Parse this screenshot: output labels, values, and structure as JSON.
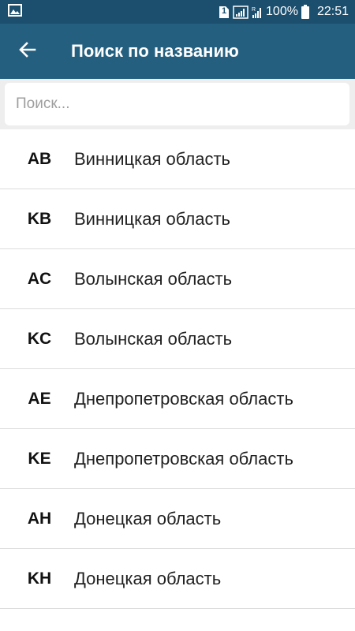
{
  "status_bar": {
    "sim_label": "1",
    "battery": "100%",
    "time": "22:51",
    "icons": [
      "image-notification-icon",
      "sim-icon",
      "signal-icon",
      "mobile-data-icon",
      "battery-icon"
    ]
  },
  "app_bar": {
    "title": "Поиск по названию",
    "back_icon": "arrow-left-icon",
    "background": "#245f80",
    "status_background": "#1c4f6e"
  },
  "search": {
    "placeholder": "Поиск...",
    "value": ""
  },
  "list": {
    "items": [
      {
        "code": "AB",
        "region": "Винницкая область"
      },
      {
        "code": "KB",
        "region": "Винницкая область"
      },
      {
        "code": "AC",
        "region": "Волынская область"
      },
      {
        "code": "KC",
        "region": "Волынская область"
      },
      {
        "code": "AE",
        "region": "Днепропетровская область"
      },
      {
        "code": "KE",
        "region": "Днепропетровская область"
      },
      {
        "code": "AH",
        "region": "Донецкая область"
      },
      {
        "code": "KH",
        "region": "Донецкая область"
      }
    ]
  }
}
